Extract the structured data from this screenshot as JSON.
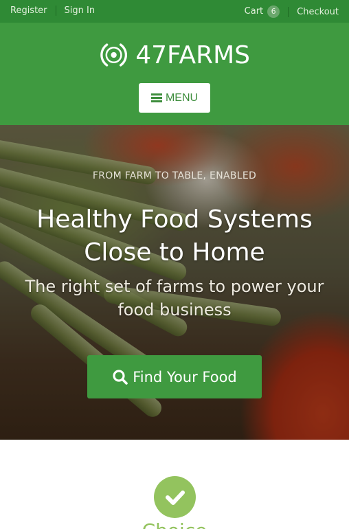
{
  "topbar": {
    "register": "Register",
    "sign_in": "Sign In",
    "cart_label": "Cart",
    "cart_count": "6",
    "checkout": "Checkout"
  },
  "header": {
    "logo_text": "47FARMS",
    "menu_label": "MENU"
  },
  "hero": {
    "eyebrow": "FROM FARM TO TABLE, ENABLED",
    "title_line1": "Healthy Food Systems",
    "title_line2": "Close to Home",
    "subtitle_line1": "The right set of farms to power your",
    "subtitle_line2": "food business",
    "cta_label": "Find Your Food"
  },
  "feature": {
    "title": "Choice"
  },
  "colors": {
    "topbar": "#2f8a35",
    "header": "#3f9a40",
    "accent_light": "#93c35e",
    "menu_text": "#3d8d3c"
  },
  "icons": {
    "logo": "target-logo-icon",
    "menu": "hamburger-icon",
    "cta": "search-icon",
    "feature": "checkmark-icon"
  }
}
